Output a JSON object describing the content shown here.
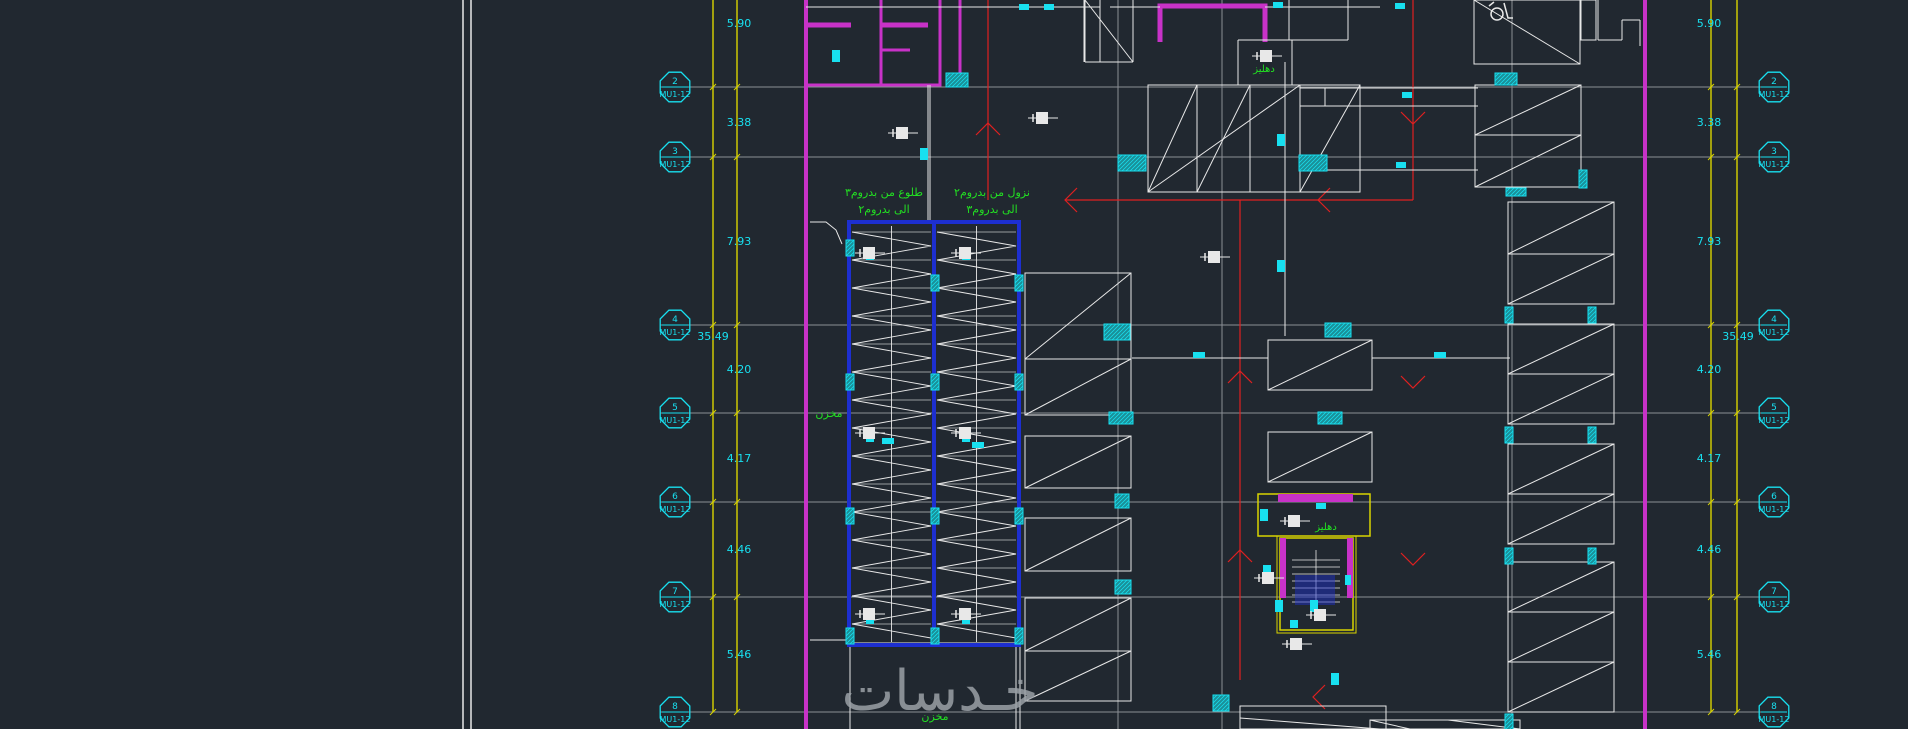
{
  "colors": {
    "background": "#212830",
    "grid": "#8a8f95",
    "dimension": "#d9d400",
    "wall": "#c832c8",
    "cyan": "#18e0f0",
    "white_lines": "#e8e8e8",
    "red": "#e02020",
    "label_green": "#22e022",
    "ramp_blue": "#1d2fd0",
    "watermark": "#9aa0a6"
  },
  "grid_bubbles": [
    {
      "num": "2",
      "ref": "MU1-12"
    },
    {
      "num": "3",
      "ref": "MU1-12"
    },
    {
      "num": "4",
      "ref": "MU1-12"
    },
    {
      "num": "5",
      "ref": "MU1-12"
    },
    {
      "num": "6",
      "ref": "MU1-12"
    },
    {
      "num": "7",
      "ref": "MU1-12"
    },
    {
      "num": "8",
      "ref": "MU1-12"
    }
  ],
  "dimensions": {
    "segments": [
      "5.90",
      "3.38",
      "7.93",
      "4.20",
      "4.17",
      "4.46",
      "5.46"
    ],
    "total": "35.49"
  },
  "labels": {
    "ramp_up": "طلوع من بدروم٣",
    "ramp_up_to": "الى بدروم٢",
    "ramp_down": "نزول من بدروم٢",
    "ramp_down_to": "الى بدروم٣",
    "storage_left": "مخزن",
    "storage_bottom": "مخزن",
    "lobby_top": "دهليز",
    "lobby_stair": "دهليز"
  },
  "watermark": {
    "text": "خـدسات"
  },
  "icons": [
    "wheelchair-icon",
    "fire-extinguisher-icon"
  ]
}
